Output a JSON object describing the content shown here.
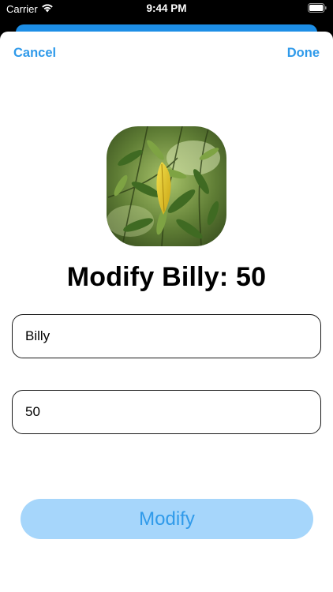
{
  "status_bar": {
    "carrier": "Carrier",
    "time": "9:44 PM",
    "wifi_icon": "wifi-icon",
    "battery_icon": "battery-icon"
  },
  "nav": {
    "cancel_label": "Cancel",
    "done_label": "Done",
    "accent_color": "#2f9aea"
  },
  "photo": {
    "subject": "leafy plant with a yellow leaf"
  },
  "title": "Modify Billy: 50",
  "form": {
    "name_value": "Billy",
    "number_value": "50"
  },
  "modify_button": {
    "label": "Modify",
    "background": "#a6d6fb"
  }
}
